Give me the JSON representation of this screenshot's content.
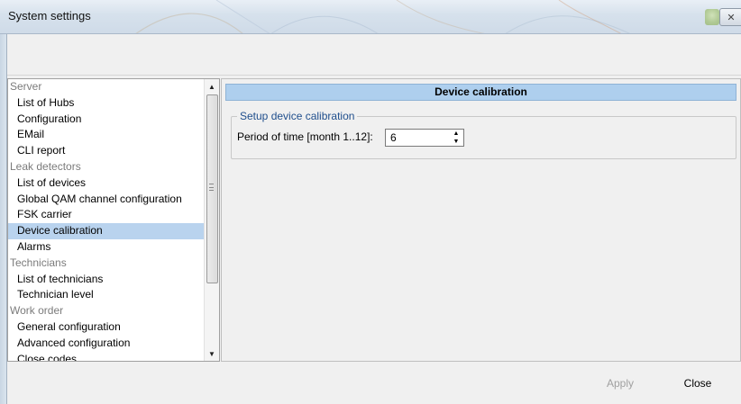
{
  "window": {
    "title": "System settings",
    "close_glyph": "✕"
  },
  "nav": {
    "items": [
      {
        "label": "Server",
        "type": "group"
      },
      {
        "label": "List of Hubs",
        "type": "child"
      },
      {
        "label": "Configuration",
        "type": "child"
      },
      {
        "label": "EMail",
        "type": "child"
      },
      {
        "label": "CLI report",
        "type": "child"
      },
      {
        "label": "Leak detectors",
        "type": "group"
      },
      {
        "label": "List of devices",
        "type": "child"
      },
      {
        "label": "Global QAM channel configuration",
        "type": "child"
      },
      {
        "label": "FSK carrier",
        "type": "child"
      },
      {
        "label": "Device calibration",
        "type": "child",
        "selected": true
      },
      {
        "label": "Alarms",
        "type": "child"
      },
      {
        "label": "Technicians",
        "type": "group"
      },
      {
        "label": "List of technicians",
        "type": "child"
      },
      {
        "label": "Technician level",
        "type": "child"
      },
      {
        "label": "Work order",
        "type": "group"
      },
      {
        "label": "General configuration",
        "type": "child"
      },
      {
        "label": "Advanced configuration",
        "type": "child"
      },
      {
        "label": "Close codes",
        "type": "child"
      }
    ],
    "scroll_up_glyph": "▲",
    "scroll_down_glyph": "▼"
  },
  "content": {
    "header": "Device calibration",
    "group_title": "Setup device calibration",
    "period_label": "Period of time [month 1..12]:",
    "period_value": "6",
    "spin_up_glyph": "▲",
    "spin_down_glyph": "▼"
  },
  "buttons": {
    "apply": "Apply",
    "close": "Close"
  },
  "colors": {
    "selected_row": "#b9d3ee",
    "header_bg": "#aecfee",
    "group_text": "#7b7b7b",
    "disabled_text": "#a0a0a0"
  }
}
